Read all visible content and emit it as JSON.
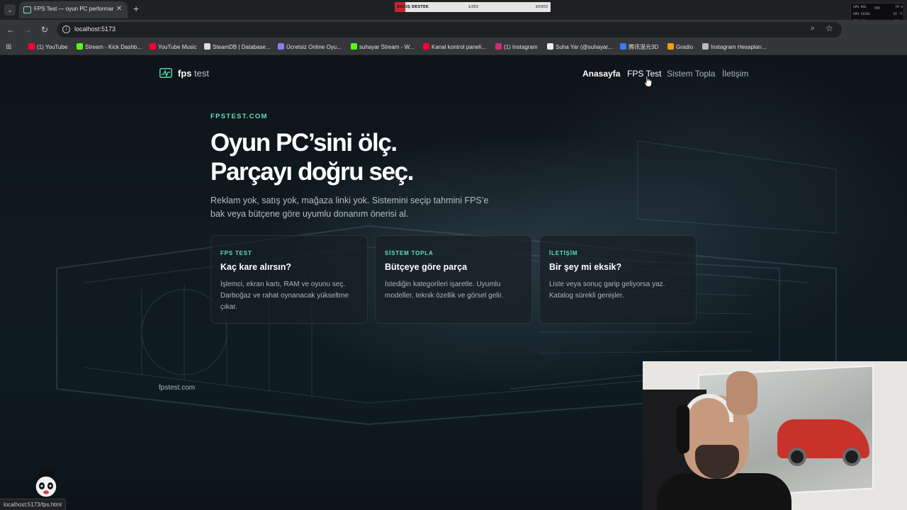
{
  "browser": {
    "tab": {
      "title": "FPS Test — oyun PC performan",
      "close_label": "✕"
    },
    "new_tab_label": "+",
    "address": "localhost:5173",
    "bookmarks": [
      {
        "label": "(1) YouTube",
        "icon_color": "#ff0033"
      },
      {
        "label": "Stream - Kick Dashb...",
        "icon_color": "#53fc18"
      },
      {
        "label": "YouTube Music",
        "icon_color": "#ff0033"
      },
      {
        "label": "SteamDB | Database...",
        "icon_color": "#dddddd"
      },
      {
        "label": "Ücretsiz Online Oyu...",
        "icon_color": "#8c7cf0"
      },
      {
        "label": "suhayar Stream - W...",
        "icon_color": "#53fc18"
      },
      {
        "label": "Kanal kontrol paneli...",
        "icon_color": "#ff0033"
      },
      {
        "label": "(1) Instagram",
        "icon_color": "#d62976"
      },
      {
        "label": "Suha Yar (@suhayar...",
        "icon_color": "#eeeeee"
      },
      {
        "label": "腾讯混元3D",
        "icon_color": "#3d7bf6"
      },
      {
        "label": "Gradio",
        "icon_color": "#f59e0b"
      },
      {
        "label": "Instagram Hesapları...",
        "icon_color": "#bbbbbb"
      }
    ],
    "status_url": "localhost:5173/fps.html"
  },
  "overlay": {
    "donation": {
      "label": "BAĞIŞ DESTEK",
      "current": "$350",
      "goal": "$5000",
      "progress": 0.07,
      "color": "#c9242e"
    },
    "sysmon": [
      {
        "label": "GPU KUL",
        "value": "79 %"
      },
      {
        "label": "GPU SICKL",
        "value": "52 °C"
      },
      {
        "label": "CPU KUL",
        "value": "29 %"
      },
      {
        "label": "CPU TEMP",
        "value": "69 °C"
      }
    ]
  },
  "site": {
    "logo_primary": "fps",
    "logo_secondary": "test",
    "nav": {
      "home": "Anasayfa",
      "fps": "FPS Test",
      "build": "Sistem Topla",
      "contact": "İletişim"
    },
    "hero": {
      "eyebrow": "FPSTEST.COM",
      "title_line1": "Oyun PC’sini ölç.",
      "title_line2": "Parçayı doğru seç.",
      "description": "Reklam yok, satış yok, mağaza linki yok. Sistemini seçip tahmini FPS’e bak veya bütçene göre uyumlu donanım önerisi al."
    },
    "cards": [
      {
        "kicker": "FPS TEST",
        "title": "Kaç kare alırsın?",
        "text": "İşlemci, ekran kartı, RAM ve oyunu seç. Darboğaz ve rahat oynanacak yükseltme çıkar."
      },
      {
        "kicker": "SİSTEM TOPLA",
        "title": "Bütçeye göre parça",
        "text": "İstediğin kategorileri işaretle. Uyumlu modeller, teknik özellik ve görsel gelir."
      },
      {
        "kicker": "İLETİŞİM",
        "title": "Bir şey mi eksik?",
        "text": "Liste veya sonuç garip geliyorsa yaz. Katalog sürekli genişler."
      }
    ],
    "footer": "fpstest.com",
    "accent_color": "#5ee3b5"
  }
}
